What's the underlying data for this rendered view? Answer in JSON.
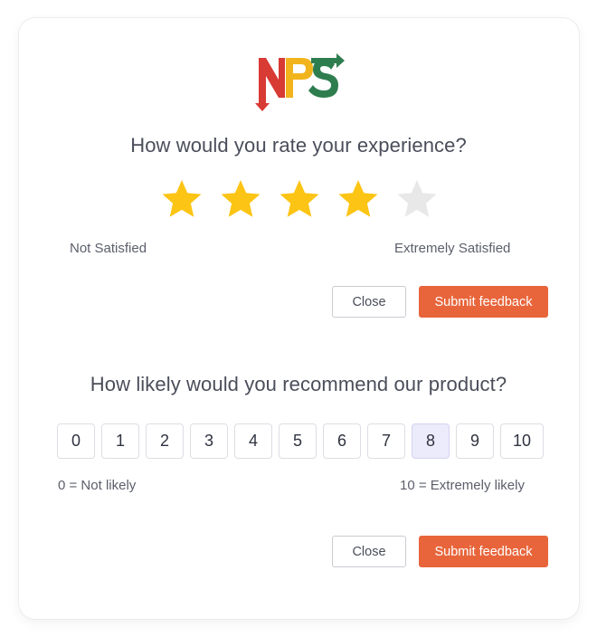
{
  "logo": {
    "text": "NPS",
    "colors": {
      "n": "#d83a34",
      "p": "#f2b41c",
      "s": "#2e7d4f"
    }
  },
  "rating": {
    "question": "How would you rate your experience?",
    "max_stars": 5,
    "value": 4,
    "low_label": "Not Satisfied",
    "high_label": "Extremely Satisfied",
    "close_label": "Close",
    "submit_label": "Submit feedback"
  },
  "nps": {
    "question": "How likely would you recommend our product?",
    "options": [
      "0",
      "1",
      "2",
      "3",
      "4",
      "5",
      "6",
      "7",
      "8",
      "9",
      "10"
    ],
    "selected": "8",
    "low_label": "0 = Not likely",
    "high_label": "10 = Extremely likely",
    "close_label": "Close",
    "submit_label": "Submit feedback"
  },
  "colors": {
    "star_filled": "#fcc414",
    "star_empty": "#e8e8e8",
    "submit_bg": "#e8653b",
    "selected_bg": "#ecebfb"
  }
}
